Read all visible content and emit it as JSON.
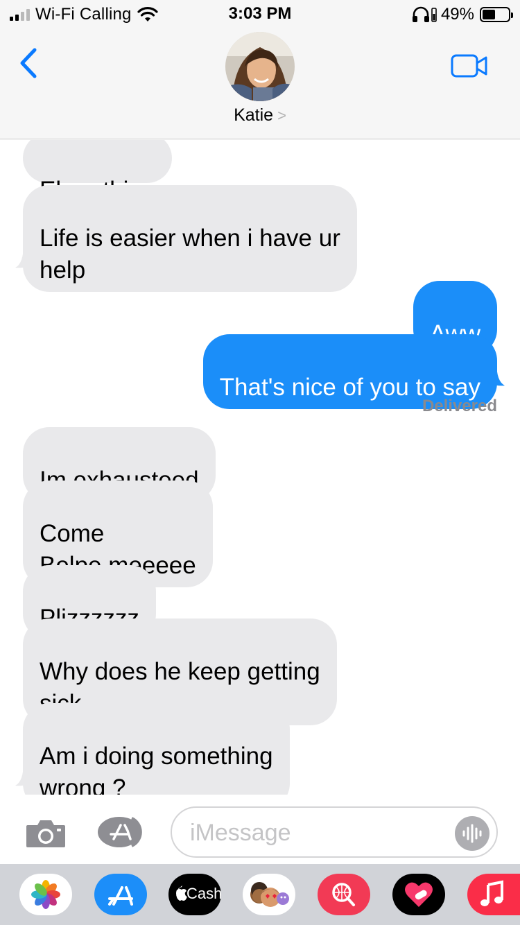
{
  "status_bar": {
    "carrier": "Wi-Fi Calling",
    "time": "3:03 PM",
    "battery": "49%",
    "battery_level": 0.49
  },
  "header": {
    "contact_name": "Katie",
    "back_icon": "chevron-left-icon",
    "video_icon": "video-camera-icon"
  },
  "messages": [
    {
      "from": "them",
      "text": "Eberything"
    },
    {
      "from": "them",
      "text": "Life is easier when i have ur\nhelp"
    },
    {
      "from": "me",
      "text": "Aww"
    },
    {
      "from": "me",
      "text": "That's nice of you to say"
    },
    {
      "from": "them",
      "text": "Im exhausteed"
    },
    {
      "from": "them",
      "text": "Come\nBelpe meeeee"
    },
    {
      "from": "them",
      "text": "Plizzzzzz"
    },
    {
      "from": "them",
      "text": "Why does he keep getting\nsick"
    },
    {
      "from": "them",
      "text": "Am i doing something\nwrong ?"
    }
  ],
  "delivered_label": "Delivered",
  "input": {
    "placeholder": "iMessage"
  },
  "app_drawer": {
    "apps": [
      {
        "name": "Photos",
        "icon": "photos-icon"
      },
      {
        "name": "App Store",
        "icon": "app-store-icon"
      },
      {
        "name": "Cash",
        "icon": "cash-icon",
        "label": "Cash"
      },
      {
        "name": "Memoji",
        "icon": "memoji-icon"
      },
      {
        "name": "Web Search",
        "icon": "search-globe-icon"
      },
      {
        "name": "Stickers",
        "icon": "heart-sticker-icon"
      },
      {
        "name": "Music",
        "icon": "music-icon"
      }
    ]
  },
  "colors": {
    "bubble_in": "#e9e9eb",
    "bubble_out": "#1b8ef9",
    "ios_blue": "#0a7aff",
    "header_bg": "#f6f6f6"
  }
}
